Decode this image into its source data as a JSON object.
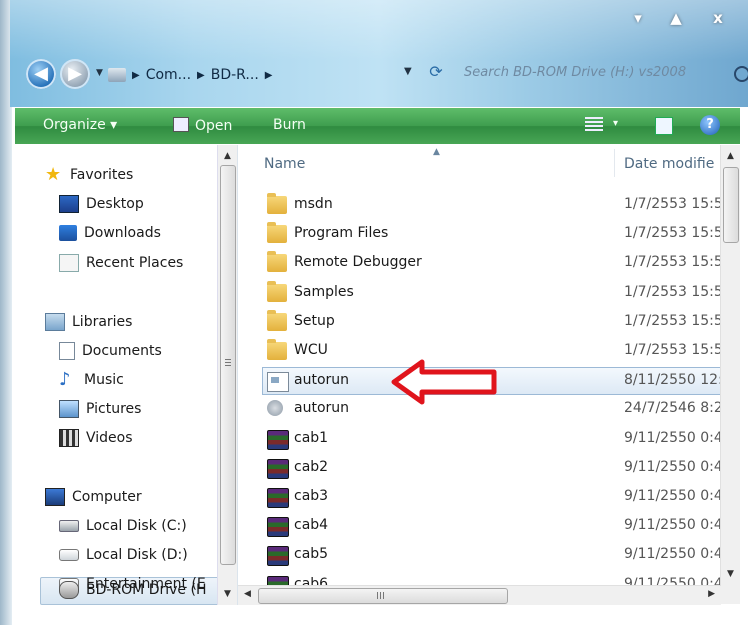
{
  "window": {
    "minimize_glyph": "▾",
    "maximize_glyph": "▲",
    "close_glyph": "x"
  },
  "address": {
    "back_glyph": "◀",
    "forward_glyph": "▶",
    "crumbs": [
      "Com...",
      "BD-R..."
    ],
    "search_placeholder": "Search BD-ROM Drive (H:) vs2008"
  },
  "toolbar": {
    "organize": "Organize ▾",
    "open": "Open",
    "burn": "Burn",
    "views_caret": "▾",
    "help": "?"
  },
  "nav": {
    "favorites": "Favorites",
    "desktop": "Desktop",
    "downloads": "Downloads",
    "recent": "Recent Places",
    "libraries": "Libraries",
    "documents": "Documents",
    "music": "Music",
    "pictures": "Pictures",
    "videos": "Videos",
    "computer": "Computer",
    "disk_c": "Local Disk (C:)",
    "disk_d": "Local Disk (D:)",
    "entertainment": "Entertainment (E",
    "bdrom": "BD-ROM Drive (H"
  },
  "columns": {
    "name": "Name",
    "date": "Date modifie"
  },
  "files": [
    {
      "name": "msdn",
      "date": "1/7/2553 15:5",
      "type": "folder"
    },
    {
      "name": "Program Files",
      "date": "1/7/2553 15:5",
      "type": "folder"
    },
    {
      "name": "Remote Debugger",
      "date": "1/7/2553 15:5",
      "type": "folder"
    },
    {
      "name": "Samples",
      "date": "1/7/2553 15:5",
      "type": "folder"
    },
    {
      "name": "Setup",
      "date": "1/7/2553 15:5",
      "type": "folder"
    },
    {
      "name": "WCU",
      "date": "1/7/2553 15:5",
      "type": "folder"
    },
    {
      "name": "autorun",
      "date": "8/11/2550 12:",
      "type": "inf"
    },
    {
      "name": "autorun",
      "date": "24/7/2546 8:2",
      "type": "exe"
    },
    {
      "name": "cab1",
      "date": "9/11/2550 0:4",
      "type": "rar"
    },
    {
      "name": "cab2",
      "date": "9/11/2550 0:4",
      "type": "rar"
    },
    {
      "name": "cab3",
      "date": "9/11/2550 0:4",
      "type": "rar"
    },
    {
      "name": "cab4",
      "date": "9/11/2550 0:4",
      "type": "rar"
    },
    {
      "name": "cab5",
      "date": "9/11/2550 0:4",
      "type": "rar"
    },
    {
      "name": "cab6",
      "date": "9/11/2550 0:4",
      "type": "rar"
    }
  ],
  "scroll_glyphs": {
    "up": "▲",
    "down": "▼",
    "left": "◀",
    "right": "▶"
  },
  "colors": {
    "toolbar_green": "#3e9d4e",
    "selection_border": "#9cb9d6",
    "annotation_arrow": "#e0141c"
  }
}
